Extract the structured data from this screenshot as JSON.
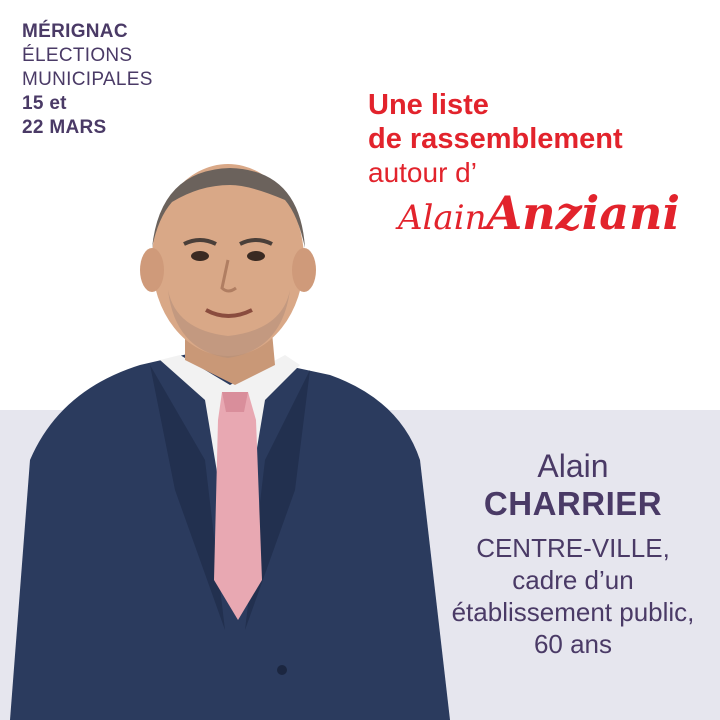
{
  "election": {
    "city": "MÉRIGNAC",
    "line2": "ÉLECTIONS",
    "line3": "MUNICIPALES",
    "date1": "15 et",
    "date2": "22 MARS"
  },
  "headline": {
    "line1": "Une liste",
    "line2": "de rassemblement",
    "line3": "autour d’",
    "signature_first": "Alain",
    "signature_last": "Anziani"
  },
  "candidate": {
    "first_name": "Alain",
    "last_name": "CHARRIER",
    "details": [
      "CENTRE-VILLE,",
      "cadre d’un",
      "établissement public,",
      "60 ans"
    ]
  },
  "colors": {
    "accent_red": "#e2232c",
    "text_purple": "#4a3a66",
    "band_gray": "#e6e6ee"
  }
}
